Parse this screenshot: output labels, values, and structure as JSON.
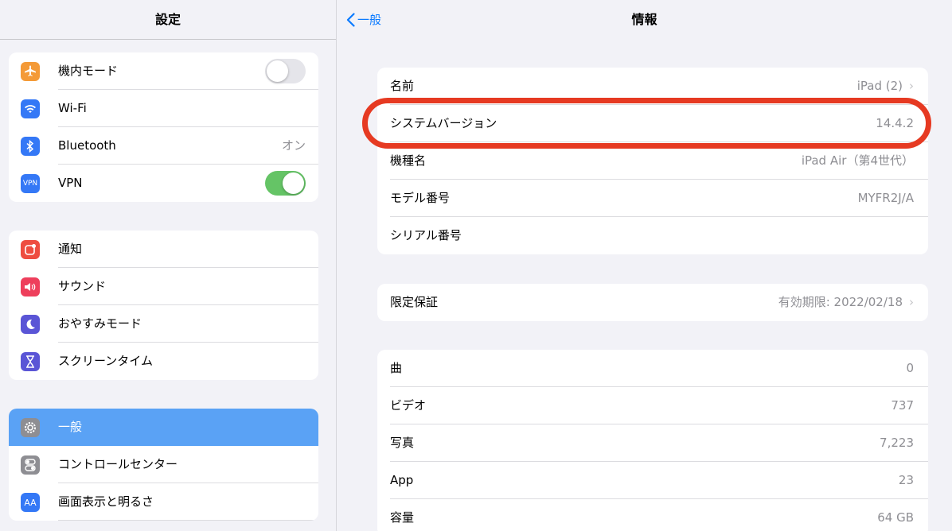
{
  "sidebar": {
    "title": "設定",
    "group1": [
      {
        "icon": "airplane-icon",
        "color": "#f49a37",
        "label": "機内モード",
        "toggle": "off"
      },
      {
        "icon": "wifi-icon",
        "color": "#3478f6",
        "label": "Wi-Fi"
      },
      {
        "icon": "bluetooth-icon",
        "color": "#3478f6",
        "label": "Bluetooth",
        "value": "オン"
      },
      {
        "icon": "vpn-icon",
        "color": "#3478f6",
        "icon_text": "VPN",
        "label": "VPN",
        "toggle": "on"
      }
    ],
    "group2": [
      {
        "icon": "notifications-icon",
        "color": "#ee4d40",
        "label": "通知"
      },
      {
        "icon": "sound-icon",
        "color": "#ee3f5c",
        "label": "サウンド"
      },
      {
        "icon": "moon-icon",
        "color": "#5a55d6",
        "label": "おやすみモード"
      },
      {
        "icon": "hourglass-icon",
        "color": "#5a55d6",
        "label": "スクリーンタイム"
      }
    ],
    "group3": [
      {
        "icon": "gear-icon",
        "color": "#8e8e93",
        "label": "一般",
        "selected": true
      },
      {
        "icon": "control-center-icon",
        "color": "#8e8e93",
        "label": "コントロールセンター"
      },
      {
        "icon": "display-icon",
        "color": "#3478f6",
        "icon_text": "AA",
        "label": "画面表示と明るさ"
      }
    ]
  },
  "detail": {
    "back_label": "一般",
    "title": "情報",
    "group1": [
      {
        "label": "名前",
        "value": "iPad (2)",
        "chevron": true
      },
      {
        "label": "システムバージョン",
        "value": "14.4.2"
      },
      {
        "label": "機種名",
        "value": "iPad Air（第4世代）"
      },
      {
        "label": "モデル番号",
        "value": "MYFR2J/A"
      },
      {
        "label": "シリアル番号",
        "value": ""
      }
    ],
    "group2": [
      {
        "label": "限定保証",
        "value": "有効期限: 2022/02/18",
        "chevron": true
      }
    ],
    "group3": [
      {
        "label": "曲",
        "value": "0"
      },
      {
        "label": "ビデオ",
        "value": "737"
      },
      {
        "label": "写真",
        "value": "7,223"
      },
      {
        "label": "App",
        "value": "23"
      },
      {
        "label": "容量",
        "value": "64 GB"
      }
    ]
  },
  "colors": {
    "accent": "#0a7aff",
    "highlight": "#e63a22",
    "selected": "#5aa2f5"
  }
}
